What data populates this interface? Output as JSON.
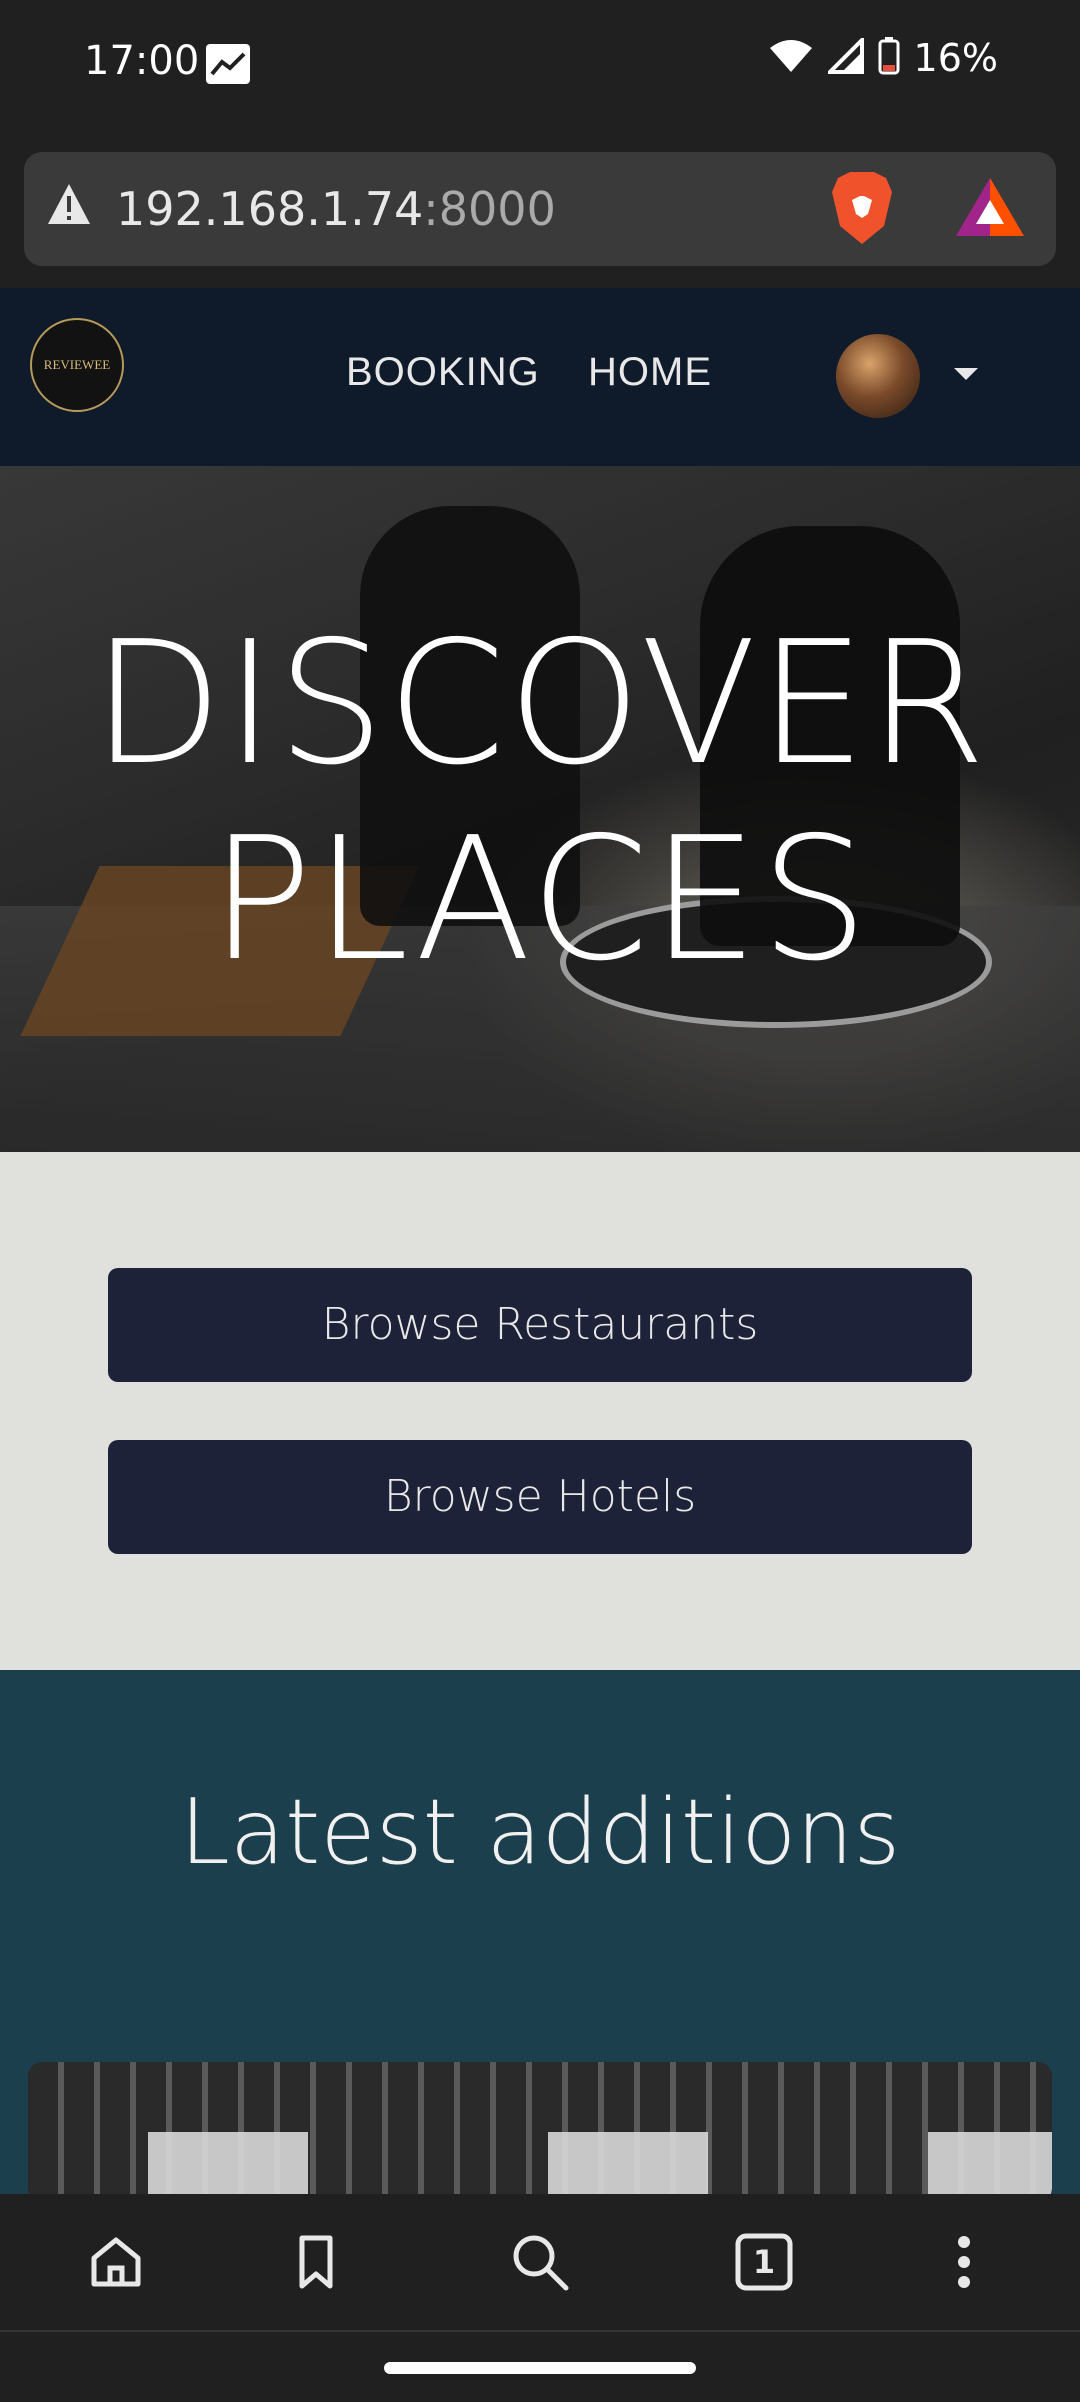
{
  "status_bar": {
    "time": "17:00",
    "battery": "16%",
    "icons": [
      "gallery-icon",
      "wifi-icon",
      "signal-icon",
      "battery-icon"
    ]
  },
  "browser": {
    "url_host": "192.168.1.74",
    "url_port": ":8000",
    "icons": [
      "warning-icon",
      "brave-shield-icon",
      "bat-rewards-icon"
    ]
  },
  "site_nav": {
    "logo_text": "REVIEWEE",
    "links": [
      "BOOKING",
      "HOME"
    ]
  },
  "hero": {
    "title": "DISCOVER PLACES"
  },
  "actions": {
    "browse_restaurants": "Browse Restaurants",
    "browse_hotels": "Browse Hotels"
  },
  "latest": {
    "title": "Latest additions"
  },
  "toolbar": {
    "tabs_count": "1",
    "icons": [
      "home-icon",
      "bookmark-icon",
      "search-icon",
      "tabs-icon",
      "more-icon"
    ]
  },
  "colors": {
    "nav_bg": "#0f1a2a",
    "button_bg": "#1e2238",
    "latest_bg": "#1b3f4c",
    "section_bg": "#e0e0dd"
  }
}
